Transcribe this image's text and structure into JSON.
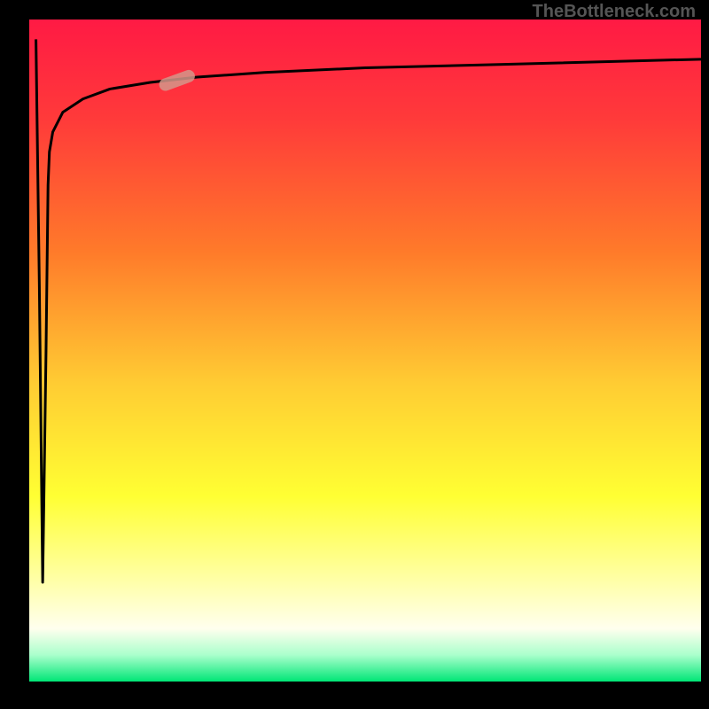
{
  "watermark_text": "TheBottleneck.com",
  "chart_data": {
    "type": "line",
    "title": "",
    "xlabel": "",
    "ylabel": "",
    "xlim": [
      0,
      100
    ],
    "ylim": [
      0,
      100
    ],
    "background_gradient": {
      "stops": [
        {
          "offset": 0,
          "color": "#ff1a44"
        },
        {
          "offset": 0.15,
          "color": "#ff3a3a"
        },
        {
          "offset": 0.35,
          "color": "#ff7a2a"
        },
        {
          "offset": 0.55,
          "color": "#ffcc33"
        },
        {
          "offset": 0.72,
          "color": "#ffff33"
        },
        {
          "offset": 0.85,
          "color": "#ffffaa"
        },
        {
          "offset": 0.92,
          "color": "#ffffee"
        },
        {
          "offset": 0.96,
          "color": "#aaffcc"
        },
        {
          "offset": 1.0,
          "color": "#00e676"
        }
      ]
    },
    "series": [
      {
        "name": "curve",
        "color": "#000000",
        "x": [
          1,
          1.5,
          2,
          2.5,
          2.8,
          3,
          3.5,
          5,
          8,
          12,
          18,
          25,
          35,
          50,
          70,
          100
        ],
        "y": [
          97,
          60,
          15,
          50,
          75,
          80,
          83,
          86,
          88,
          89.5,
          90.5,
          91.3,
          92,
          92.7,
          93.2,
          94
        ]
      }
    ],
    "marker": {
      "x": 22,
      "y": 90.8,
      "color": "#d4968a",
      "angle": 20
    }
  }
}
